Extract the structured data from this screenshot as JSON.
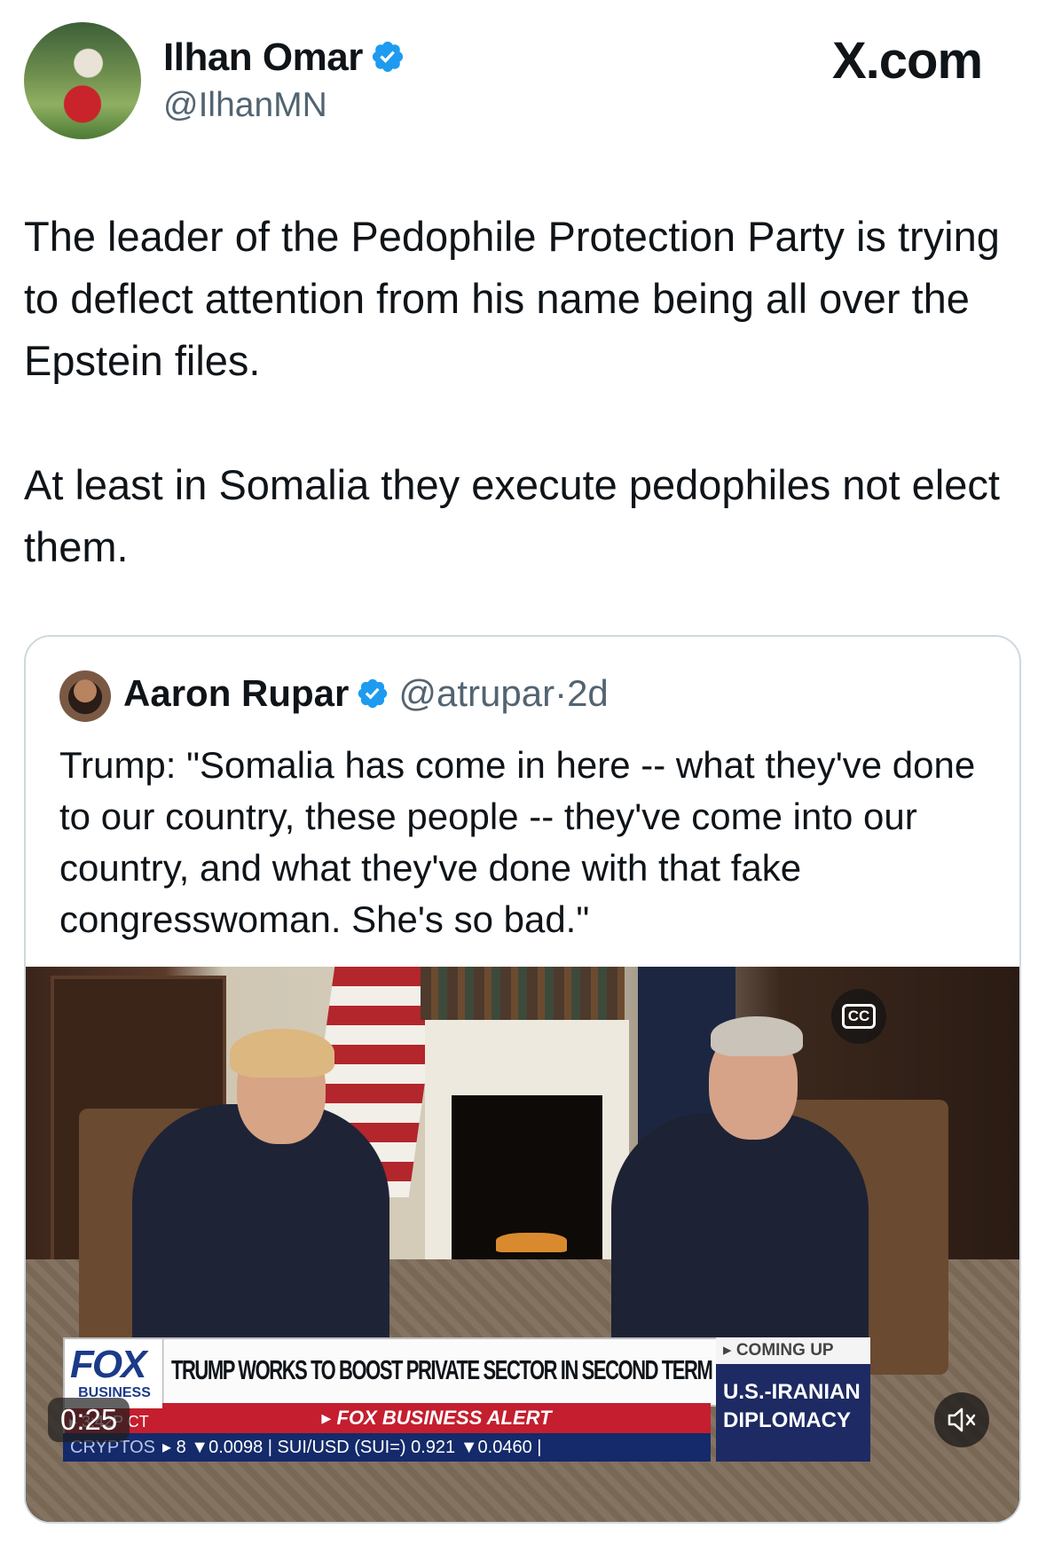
{
  "site_label": "X.com",
  "author": {
    "name": "Ilhan Omar",
    "handle": "@IlhanMN"
  },
  "tweet": {
    "paragraph_1": "The leader of the Pedophile Protection Party is trying to deflect attention from his name being all over the Epstein files.",
    "paragraph_2": "At least in Somalia they execute pedophiles not elect them."
  },
  "quote": {
    "name": "Aaron Rupar",
    "handle": "@atrupar",
    "separator": "·",
    "age": "2d",
    "text": "Trump: \"Somalia has come in here -- what they've done to our country, these people -- they've come into our country, and what they've done with that fake congresswoman. She's so bad.\"",
    "video": {
      "elapsed": "0:25",
      "cc_label": "CC",
      "chyron": {
        "network": "FOX",
        "network_sub": "BUSINESS",
        "time": "3:42P CT",
        "headline": "TRUMP WORKS TO BOOST PRIVATE SECTOR IN SECOND TERM",
        "alert": "▸ FOX BUSINESS ALERT",
        "crawl_label": "CRYPTOS",
        "crawl_text": "▸ 8 ▼0.0098 | SUI/USD (SUI=) 0.921 ▼0.0460 |",
        "coming_up_label": "▸ COMING UP",
        "coming_up_text": "U.S.-IRANIAN DIPLOMACY"
      }
    }
  },
  "colors": {
    "verified": "#1d9bf0",
    "secondary_text": "#536471",
    "border": "#cfd9de"
  }
}
